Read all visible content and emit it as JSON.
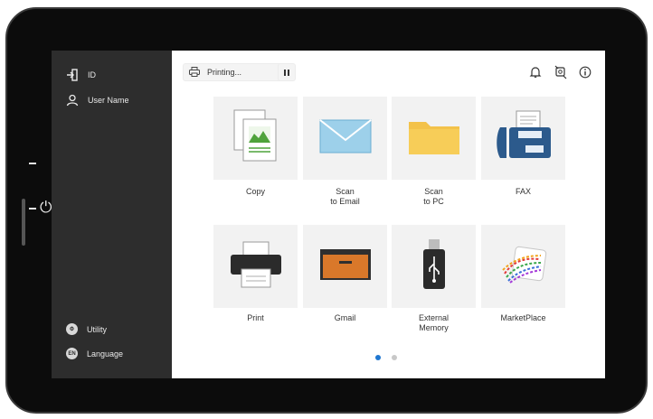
{
  "sidebar": {
    "id_label": "ID",
    "user_label": "User Name",
    "utility_label": "Utility",
    "language_label": "Language",
    "language_badge": "EN"
  },
  "topbar": {
    "status_text": "Printing..."
  },
  "apps": [
    {
      "label": "Copy",
      "icon": "copy-icon"
    },
    {
      "label": "Scan\nto Email",
      "icon": "email-icon"
    },
    {
      "label": "Scan\nto PC",
      "icon": "folder-icon"
    },
    {
      "label": "FAX",
      "icon": "fax-icon"
    },
    {
      "label": "Print",
      "icon": "printer-icon"
    },
    {
      "label": "Gmail",
      "icon": "drawer-icon"
    },
    {
      "label": "External\nMemory",
      "icon": "usb-icon"
    },
    {
      "label": "MarketPlace",
      "icon": "marketplace-icon"
    }
  ],
  "pagination": {
    "pages": 2,
    "active": 1
  },
  "colors": {
    "sidebar_bg": "#2d2d2d",
    "tile_bg": "#f2f2f2",
    "accent": "#1f77d0",
    "folder": "#f3c24a",
    "email": "#8ec8e6",
    "fax": "#2c5a8c",
    "drawer": "#d9782a"
  }
}
